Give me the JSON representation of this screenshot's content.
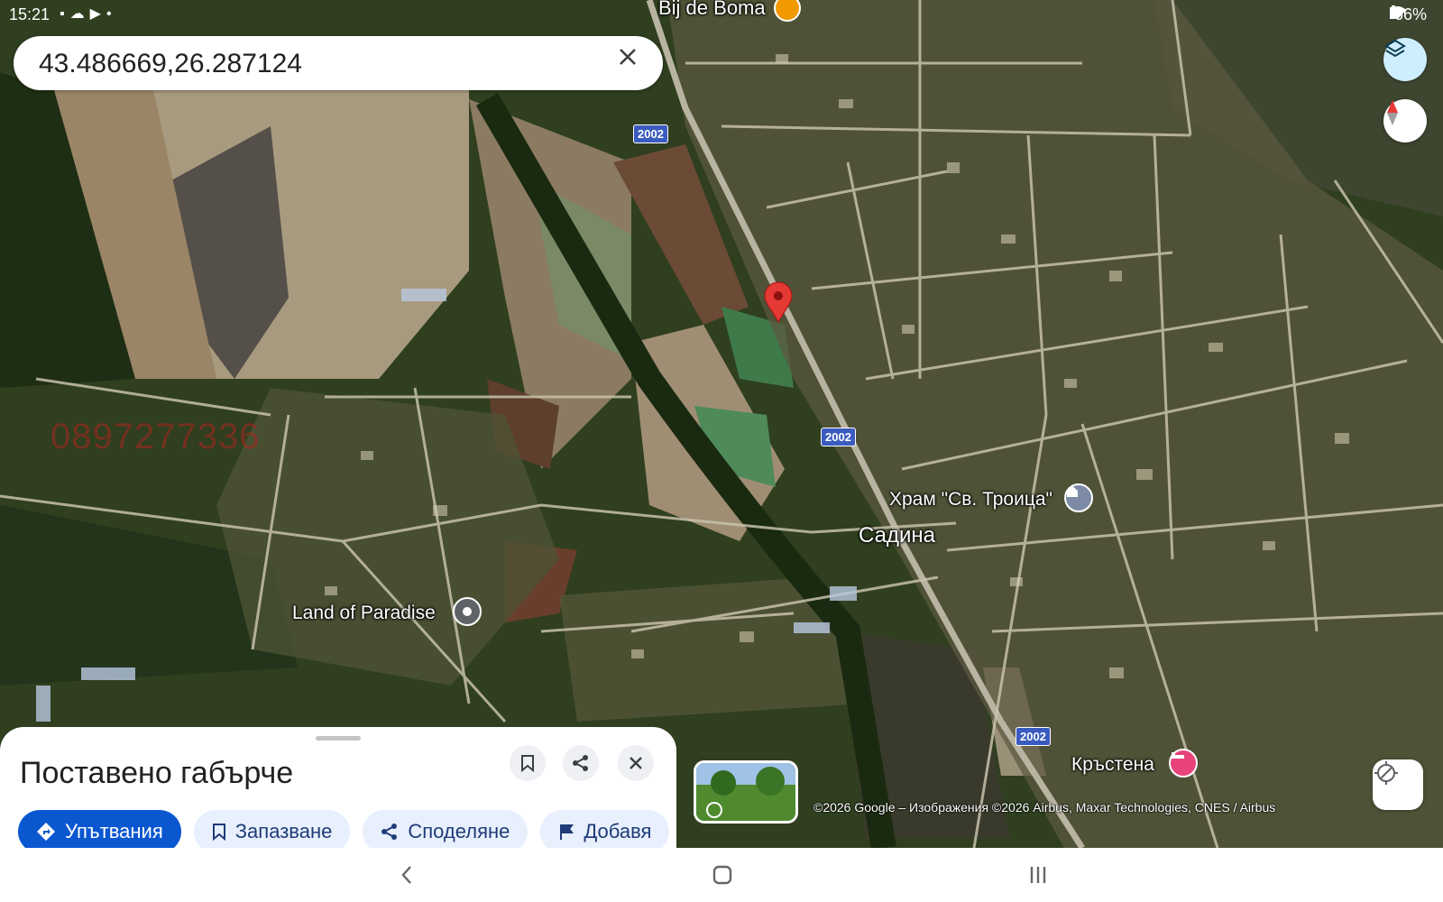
{
  "status_bar": {
    "time": "15:21",
    "battery": "66%"
  },
  "search": {
    "value": "43.486669,26.287124"
  },
  "map": {
    "labels": {
      "bij_de_boma": "Bij de Boma",
      "temple": "Храм \"Св. Троица\"",
      "sadina": "Садина",
      "land_of_paradise": "Land of Paradise",
      "krastena": "Кръстена"
    },
    "road_shield": "2002",
    "watermark": "0897277336",
    "attribution": "©2026 Google – Изображения ©2026 Airbus, Maxar Technologies, CNES / Airbus"
  },
  "bottom_sheet": {
    "title": "Поставено габърче",
    "chips": {
      "directions": "Упътвания",
      "save": "Запазване",
      "share": "Споделяне",
      "add": "Добавя"
    }
  },
  "colors": {
    "primary": "#0b57d0",
    "chip_bg": "#e8f0fe",
    "pin": "#e53935"
  }
}
